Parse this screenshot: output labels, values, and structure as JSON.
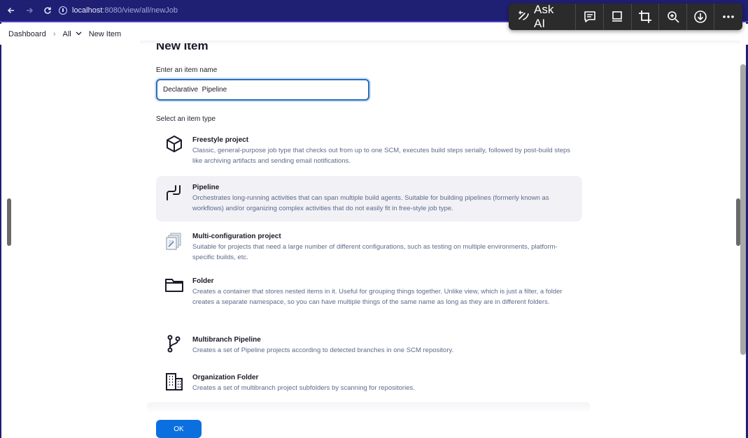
{
  "browser": {
    "url_host": "localhost",
    "url_rest": ":8080/view/all/newJob"
  },
  "ai_toolbar": {
    "ask_label": "Ask AI"
  },
  "breadcrumb": {
    "items": [
      "Dashboard",
      "All",
      "New Item"
    ]
  },
  "page": {
    "title": "New Item",
    "name_label": "Enter an item name",
    "name_value": "Declarative  Pipeline",
    "type_label": "Select an item type"
  },
  "item_types": [
    {
      "name": "Freestyle project",
      "description": "Classic, general-purpose job type that checks out from up to one SCM, executes build steps serially, followed by post-build steps like archiving artifacts and sending email notifications.",
      "icon": "freestyle-icon"
    },
    {
      "name": "Pipeline",
      "description": "Orchestrates long-running activities that can span multiple build agents. Suitable for building pipelines (formerly known as workflows) and/or organizing complex activities that do not easily fit in free-style job type.",
      "icon": "pipeline-icon",
      "selected": true
    },
    {
      "name": "Multi-configuration project",
      "description": "Suitable for projects that need a large number of different configurations, such as testing on multiple environments, platform-specific builds, etc.",
      "icon": "multi-config-icon"
    },
    {
      "name": "Folder",
      "description": "Creates a container that stores nested items in it. Useful for grouping things together. Unlike view, which is just a filter, a folder creates a separate namespace, so you can have multiple things of the same name as long as they are in different folders.",
      "icon": "folder-icon"
    },
    {
      "name": "Multibranch Pipeline",
      "description": "Creates a set of Pipeline projects according to detected branches in one SCM repository.",
      "icon": "branch-icon"
    },
    {
      "name": "Organization Folder",
      "description": "Creates a set of multibranch project subfolders by scanning for repositories.",
      "icon": "organization-icon"
    }
  ],
  "actions": {
    "ok_label": "OK"
  },
  "colors": {
    "accent": "#0b6fe0",
    "browser_bar": "#1f1f74",
    "description_text": "#5e6a8a",
    "selected_bg": "#f1f1f6"
  }
}
